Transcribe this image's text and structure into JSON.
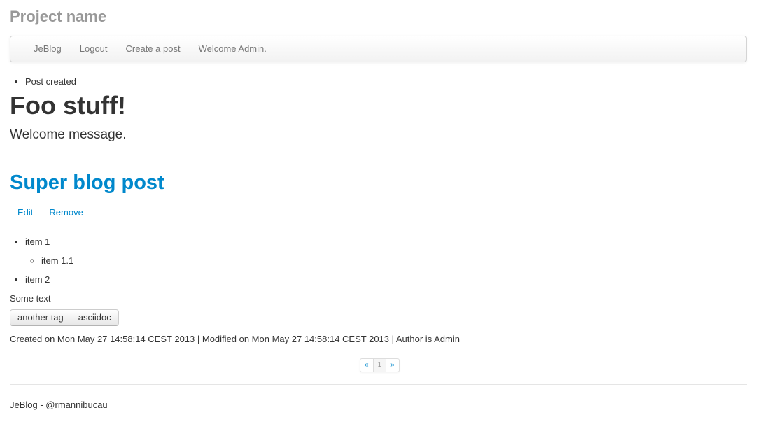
{
  "header": {
    "brand": "Project name"
  },
  "navbar": {
    "items": [
      "JeBlog",
      "Logout",
      "Create a post",
      "Welcome Admin."
    ]
  },
  "alerts": [
    "Post created"
  ],
  "hero": {
    "title": "Foo stuff!",
    "lead": "Welcome message."
  },
  "post": {
    "title": "Super blog post",
    "actions": {
      "edit": "Edit",
      "remove": "Remove"
    },
    "content": {
      "items": [
        {
          "label": "item 1",
          "children": [
            "item 1.1"
          ]
        },
        {
          "label": "item 2"
        }
      ],
      "text": "Some text"
    },
    "tags": [
      "another tag",
      "asciidoc"
    ],
    "meta": "Created on Mon May 27 14:58:14 CEST 2013 | Modified on Mon May 27 14:58:14 CEST 2013 | Author is Admin"
  },
  "pagination": {
    "prev": "«",
    "current": "1",
    "next": "»"
  },
  "footer": {
    "text": "JeBlog - @rmannibucau"
  }
}
